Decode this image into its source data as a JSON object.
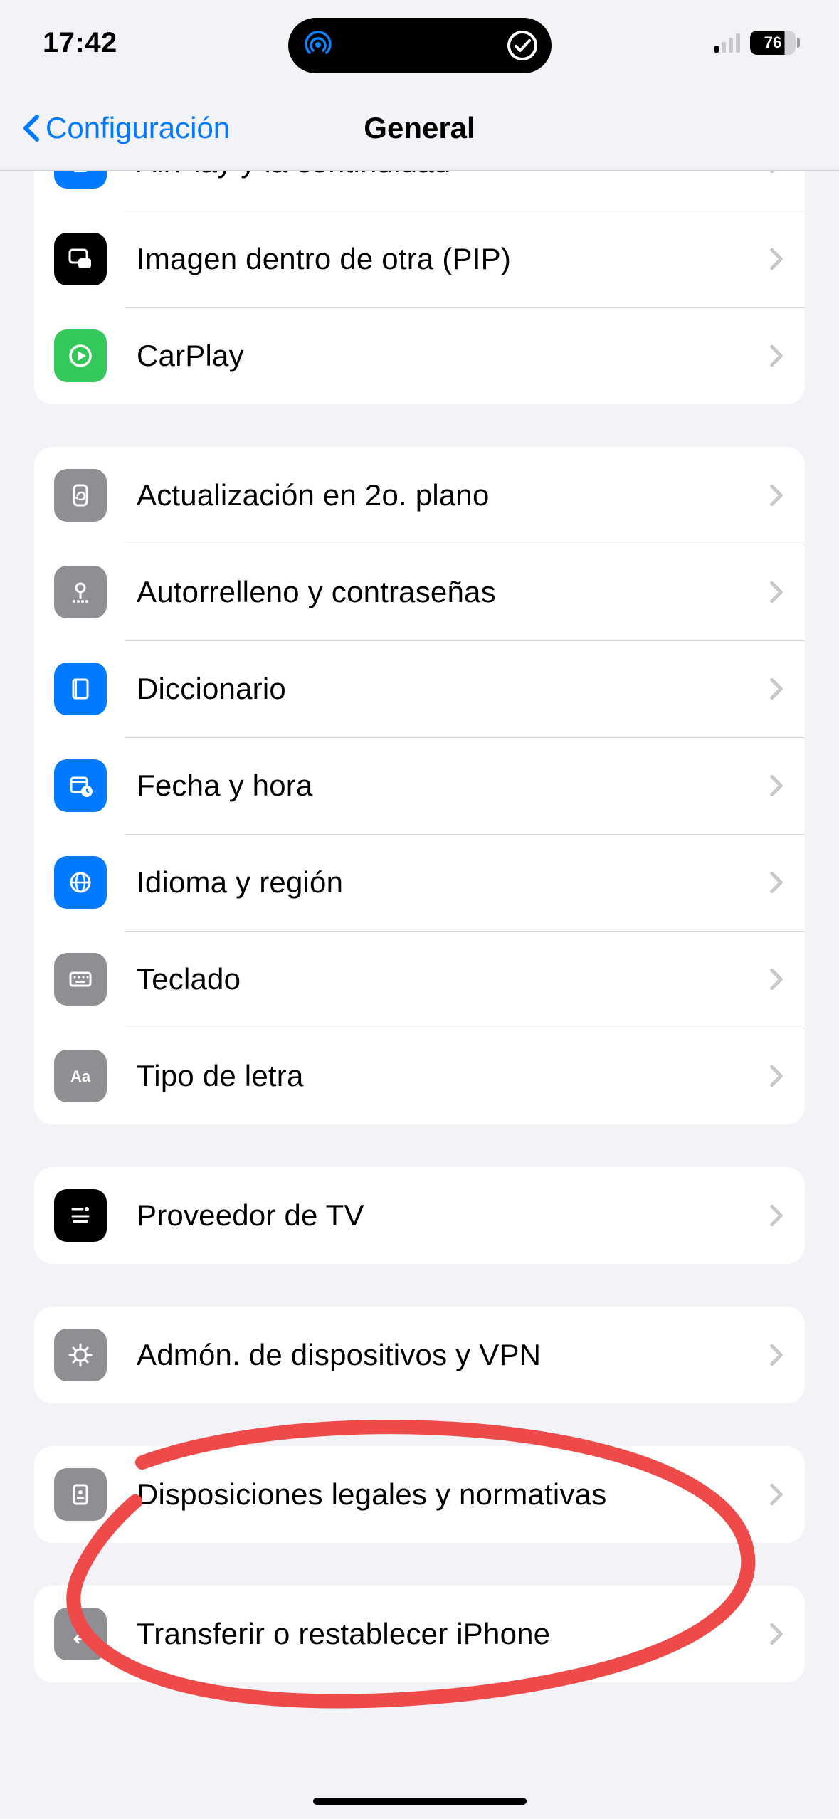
{
  "status": {
    "time": "17:42",
    "battery": "76"
  },
  "nav": {
    "back_label": "Configuración",
    "title": "General"
  },
  "group0": {
    "items": [
      {
        "label": "AirPlay y la continuidad"
      },
      {
        "label": "Imagen dentro de otra (PIP)"
      },
      {
        "label": "CarPlay"
      }
    ]
  },
  "group1": {
    "items": [
      {
        "label": "Actualización en 2o. plano"
      },
      {
        "label": "Autorrelleno y contraseñas"
      },
      {
        "label": "Diccionario"
      },
      {
        "label": "Fecha y hora"
      },
      {
        "label": "Idioma y región"
      },
      {
        "label": "Teclado"
      },
      {
        "label": "Tipo de letra"
      }
    ]
  },
  "group2": {
    "items": [
      {
        "label": "Proveedor de TV"
      }
    ]
  },
  "group3": {
    "items": [
      {
        "label": "Admón. de dispositivos y VPN"
      }
    ]
  },
  "group4": {
    "items": [
      {
        "label": "Disposiciones legales y normativas"
      }
    ]
  },
  "group5": {
    "items": [
      {
        "label": "Transferir o restablecer iPhone"
      }
    ]
  },
  "colors": {
    "ios_blue": "#007aff",
    "annotation_red": "#ef4a4a"
  }
}
